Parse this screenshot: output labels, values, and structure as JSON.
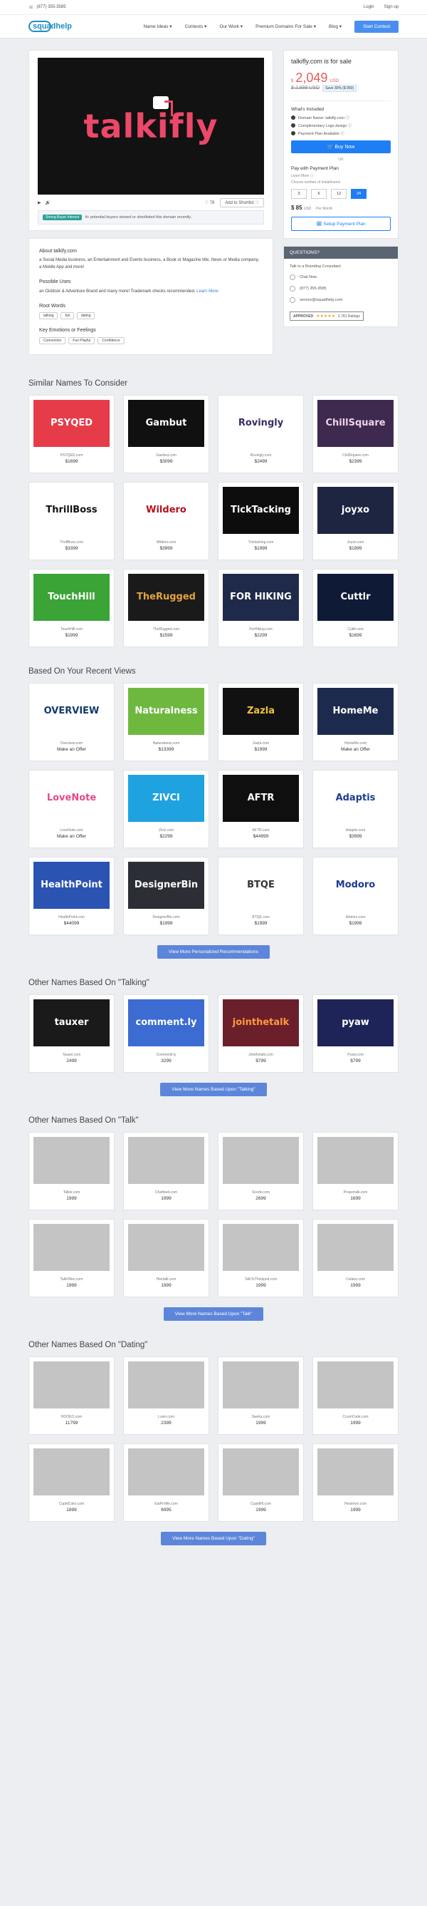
{
  "topbar": {
    "phone": "(877) 355-3585",
    "login": "Login",
    "signup": "Sign up"
  },
  "nav": {
    "logo": "squadhelp",
    "items": [
      "Name Ideas ▾",
      "Contests ▾",
      "Our Work ▾",
      "Premium Domains For Sale ▾",
      "Blog ▾"
    ],
    "cta": "Start Contest"
  },
  "preview": {
    "brand": "talkifly",
    "play": "▶",
    "vol": "🔊",
    "likes": "♡ 79",
    "bookmark": "Add to Shortlist ♡",
    "notice_badge": "Strong Buyer Interest",
    "notice_text": "4+ potential buyers viewed or shortlisted this domain recently."
  },
  "about": {
    "h1": "About talkify.com",
    "p1": "a Social Media business, an Entertainment and Events business, a Book or Magazine title, News or Media company, a Mobile App and more!",
    "h2": "Possible Uses",
    "p2": "an Outdoor & Adventure Brand and many more! Trademark checks recommended.",
    "learn": "Learn More",
    "h3": "Root Words",
    "roots": [
      "talking",
      "fail",
      "dating"
    ],
    "h4": "Key Emotions or Feelings",
    "emotions": [
      "Connection",
      "Fun Playful",
      "Confidence"
    ]
  },
  "buybox": {
    "title": "talkifly.com is for sale",
    "price_symbol": "$",
    "price": "2,049",
    "currency": "USD",
    "old": "$ 2,999 USD",
    "save": "Save 30% ($ 950)",
    "incl_h": "What's Included",
    "incl": [
      "Domain Name: talkifly.com ⓘ",
      "Complimentary Logo design ⓘ",
      "Payment Plan Available ⓘ"
    ],
    "buy": "🛒 Buy Now",
    "or": "OR",
    "pp_h": "Pay with Payment Plan",
    "pp_learn": "Learn More ⓘ",
    "pp_sub": "Choose number of Installments",
    "steps": [
      "3",
      "6",
      "12",
      "24"
    ],
    "monthly": "$ 85",
    "monthly_unit": "USD",
    "monthly_suffix": "Per Month",
    "setup": "🗓 Setup Payment Plan"
  },
  "questions": {
    "h": "QUESTIONS?",
    "sub": "Talk to a Branding Consultant",
    "chat": "Chat Now",
    "phone": "(877) 355-3585",
    "email": "service@squadhelp.com",
    "approved": "APPROVED",
    "stars": "★★★★★",
    "ratings": "2,781 Ratings"
  },
  "similar": {
    "title": "Similar Names To Consider",
    "items": [
      {
        "name": "PSYQED.com",
        "price": "$1699",
        "logo": "PSYQED",
        "bg": "#e63b49",
        "fg": "#ffffff"
      },
      {
        "name": "Gambut.com",
        "price": "$3099",
        "logo": "Gambut",
        "bg": "#101010",
        "fg": "#ffffff"
      },
      {
        "name": "Rovingly.com",
        "price": "$2499",
        "logo": "Rovingly",
        "bg": "#ffffff",
        "fg": "#3b2d63"
      },
      {
        "name": "ChillSquare.com",
        "price": "$2399",
        "logo": "ChillSquare",
        "bg": "#3e2a4f",
        "fg": "#f0d3e8"
      },
      {
        "name": "ThrillBoss.com",
        "price": "$3399",
        "logo": "ThrillBoss",
        "bg": "#ffffff",
        "fg": "#111111"
      },
      {
        "name": "Wildero.com",
        "price": "$3999",
        "logo": "Wildero",
        "bg": "#ffffff",
        "fg": "#b5121b"
      },
      {
        "name": "Ticktacking.com",
        "price": "$1999",
        "logo": "TickTacking",
        "bg": "#0d0d0d",
        "fg": "#ffffff"
      },
      {
        "name": "Joyxo.com",
        "price": "$1999",
        "logo": "joyxo",
        "bg": "#1d2540",
        "fg": "#ffffff"
      },
      {
        "name": "TouchHill.com",
        "price": "$1999",
        "logo": "TouchHill",
        "bg": "#3aa437",
        "fg": "#ffffff"
      },
      {
        "name": "TheRugged.com",
        "price": "$1599",
        "logo": "TheRugged",
        "bg": "#1a1a1a",
        "fg": "#e2a33c"
      },
      {
        "name": "ForHiking.com",
        "price": "$2299",
        "logo": "FOR HIKING",
        "bg": "#1f2a4a",
        "fg": "#ffffff"
      },
      {
        "name": "Cuttlr.com",
        "price": "$1699",
        "logo": "Cuttlr",
        "bg": "#0f1b36",
        "fg": "#ffffff"
      }
    ]
  },
  "recent": {
    "title": "Based On Your Recent Views",
    "more": "View More Personalized Recommendations",
    "items": [
      {
        "name": "Overview.com",
        "price": "Make an Offer",
        "logo": "OVERVIEW",
        "bg": "#ffffff",
        "fg": "#113a6b"
      },
      {
        "name": "Naturalness.com",
        "price": "$13399",
        "logo": "Naturalness",
        "bg": "#6fb83f",
        "fg": "#ffffff"
      },
      {
        "name": "Zazla.com",
        "price": "$1999",
        "logo": "Zazla",
        "bg": "#111111",
        "fg": "#f1c23a"
      },
      {
        "name": "HomeMe.com",
        "price": "Make an Offer",
        "logo": "HomeMe",
        "bg": "#1c2a4d",
        "fg": "#ffffff"
      },
      {
        "name": "LoveNote.com",
        "price": "Make an Offer",
        "logo": "LoveNote",
        "bg": "#ffffff",
        "fg": "#e44a8a"
      },
      {
        "name": "Zivci.com",
        "price": "$2299",
        "logo": "ZIVCI",
        "bg": "#1ea3e0",
        "fg": "#ffffff"
      },
      {
        "name": "AFTR.com",
        "price": "$44999",
        "logo": "AFTR",
        "bg": "#0f0f0f",
        "fg": "#ffffff"
      },
      {
        "name": "Adaptis.com",
        "price": "$3999",
        "logo": "Adaptis",
        "bg": "#ffffff",
        "fg": "#1d3c8e"
      },
      {
        "name": "HealthPoint.com",
        "price": "$44099",
        "logo": "HealthPoint",
        "bg": "#2b53b2",
        "fg": "#ffffff"
      },
      {
        "name": "DesignerBin.com",
        "price": "$1999",
        "logo": "DesignerBin",
        "bg": "#2c2e36",
        "fg": "#ffffff"
      },
      {
        "name": "BTQE.com",
        "price": "$1999",
        "logo": "BTQE",
        "bg": "#ffffff",
        "fg": "#333333"
      },
      {
        "name": "Modoro.com",
        "price": "$1999",
        "logo": "Modoro",
        "bg": "#ffffff",
        "fg": "#1d3c8e"
      }
    ]
  },
  "talking": {
    "title": "Other Names Based On \"Talking\"",
    "more": "View More Names Based Upon \"Talking\"",
    "items": [
      {
        "name": "Tauxer.com",
        "price": "2499",
        "logo": "tauxer",
        "bg": "#1a1a1a",
        "fg": "#ffffff"
      },
      {
        "name": "Commentl.ly",
        "price": "3299",
        "logo": "comment.ly",
        "bg": "#3c6bd1",
        "fg": "#ffffff"
      },
      {
        "name": "Jointhetalk.com",
        "price": "$799",
        "logo": "jointhetalk",
        "bg": "#6b1f2a",
        "fg": "#ff9a3c"
      },
      {
        "name": "Pyaw.com",
        "price": "$799",
        "logo": "pyaw",
        "bg": "#1e2457",
        "fg": "#ffffff"
      }
    ]
  },
  "talk": {
    "title": "Other Names Based On \"Talk\"",
    "more": "View More Names Based Upon \"Talk\"",
    "items": [
      {
        "name": "Talkie.com",
        "price": "1999"
      },
      {
        "name": "Chatfeed.com",
        "price": "1999"
      },
      {
        "name": "Soorik.com",
        "price": "2699"
      },
      {
        "name": "Propertalk.com",
        "price": "1699"
      },
      {
        "name": "TalkOften.com",
        "price": "1999"
      },
      {
        "name": "Hiertalk.com",
        "price": "1999"
      },
      {
        "name": "TalkToThinkpod.com",
        "price": "1999"
      },
      {
        "name": "Colatro.com",
        "price": "1999"
      }
    ]
  },
  "dating": {
    "title": "Other Names Based On \"Dating\"",
    "more": "View More Names Based Upon \"Dating\"",
    "items": [
      {
        "name": "HOOKO.com",
        "price": "11799"
      },
      {
        "name": "Luvio.com",
        "price": "2399"
      },
      {
        "name": "Sweka.com",
        "price": "1999"
      },
      {
        "name": "CrushCode.com",
        "price": "1999"
      },
      {
        "name": "CupidCoko.com",
        "price": "1899"
      },
      {
        "name": "EatProfile.com",
        "price": "6995"
      },
      {
        "name": "Cupidlift.com",
        "price": "1999"
      },
      {
        "name": "Heatmon.com",
        "price": "1999"
      }
    ]
  }
}
